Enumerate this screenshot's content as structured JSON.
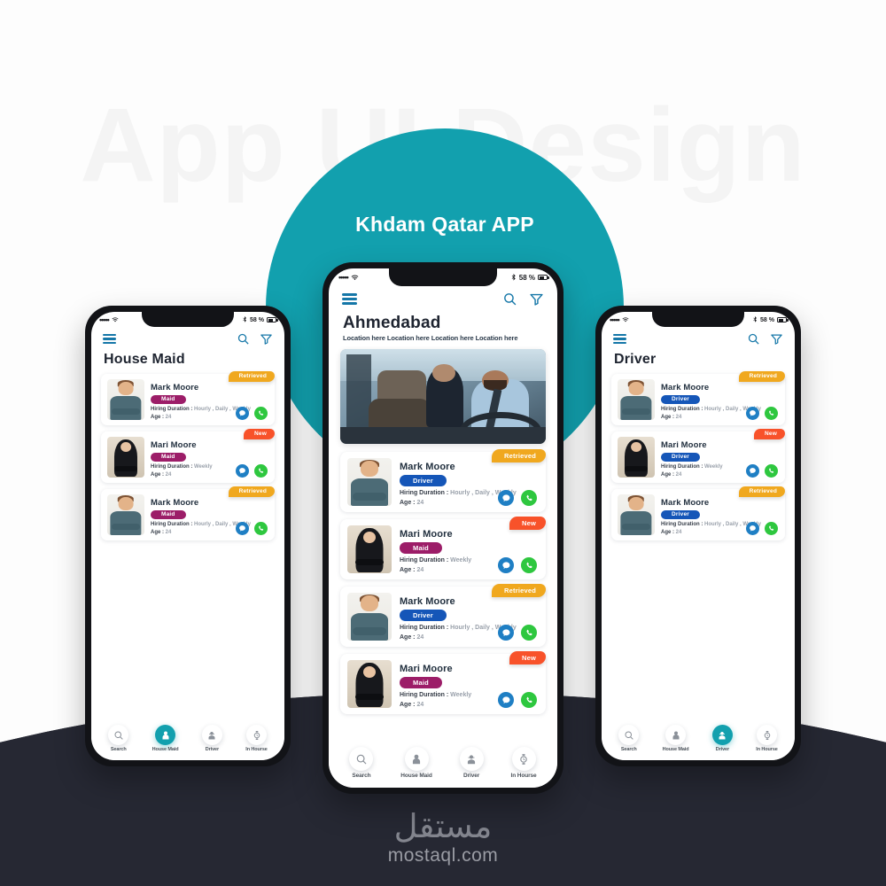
{
  "background": {
    "watermark_text": "App UI Design",
    "teal_color": "#12a0ae",
    "dark_color": "#262833"
  },
  "hero": {
    "title": "Khdam Qatar APP"
  },
  "footer_logo": {
    "arabic": "مستقل",
    "latin": "mostaql.com"
  },
  "status_bar": {
    "signal": "•••••",
    "battery_text": "58 %"
  },
  "icons": {
    "hamburger": "hamburger-menu-icon",
    "search": "search-icon",
    "filter": "filter-icon",
    "chat": "chat-bubble-icon",
    "call": "phone-call-icon"
  },
  "bottom_nav": {
    "items": [
      {
        "label": "Search",
        "icon": "search-icon"
      },
      {
        "label": "House Maid",
        "icon": "maid-person-icon"
      },
      {
        "label": "Driver",
        "icon": "driver-person-icon"
      },
      {
        "label": "In Hourse",
        "icon": "watch-clock-icon"
      }
    ]
  },
  "labels": {
    "hiring_duration": "Hiring Duration :",
    "age": "Age :"
  },
  "phones": {
    "left": {
      "title": "House Maid",
      "active_nav": "House Maid",
      "cards": [
        {
          "name": "Mark Moore",
          "role": "Maid",
          "role_type": "maid",
          "duration": "Hourly , Daily , Weekly",
          "age": "24",
          "status": "Retrieved",
          "status_type": "retrieved",
          "avatar": "male"
        },
        {
          "name": "Mari Moore",
          "role": "Maid",
          "role_type": "maid",
          "duration": "Weekly",
          "age": "24",
          "status": "New",
          "status_type": "new",
          "avatar": "female"
        },
        {
          "name": "Mark Moore",
          "role": "Maid",
          "role_type": "maid",
          "duration": "Hourly , Daily , Weekly",
          "age": "24",
          "status": "Retrieved",
          "status_type": "retrieved",
          "avatar": "male"
        }
      ]
    },
    "center": {
      "title": "Ahmedabad",
      "subtitle": "Location here Location here Location here Location here",
      "hero_image": "driver-and-passenger-in-car-photo",
      "active_nav": "",
      "cards": [
        {
          "name": "Mark Moore",
          "role": "Driver",
          "role_type": "driver",
          "duration": "Hourly , Daily , Weekly",
          "age": "24",
          "status": "Retrieved",
          "status_type": "retrieved",
          "avatar": "male"
        },
        {
          "name": "Mari Moore",
          "role": "Maid",
          "role_type": "maid",
          "duration": "Weekly",
          "age": "24",
          "status": "New",
          "status_type": "new",
          "avatar": "female"
        },
        {
          "name": "Mark Moore",
          "role": "Driver",
          "role_type": "driver",
          "duration": "Hourly , Daily , Weekly",
          "age": "24",
          "status": "Retrieved",
          "status_type": "retrieved",
          "avatar": "male"
        },
        {
          "name": "Mari Moore",
          "role": "Maid",
          "role_type": "maid",
          "duration": "Weekly",
          "age": "24",
          "status": "New",
          "status_type": "new",
          "avatar": "female"
        }
      ]
    },
    "right": {
      "title": "Driver",
      "active_nav": "Driver",
      "cards": [
        {
          "name": "Mark Moore",
          "role": "Driver",
          "role_type": "driver",
          "duration": "Hourly , Daily , Weekly",
          "age": "24",
          "status": "Retrieved",
          "status_type": "retrieved",
          "avatar": "male"
        },
        {
          "name": "Mari Moore",
          "role": "Driver",
          "role_type": "driver",
          "duration": "Weekly",
          "age": "24",
          "status": "New",
          "status_type": "new",
          "avatar": "female"
        },
        {
          "name": "Mark Moore",
          "role": "Driver",
          "role_type": "driver",
          "duration": "Hourly , Daily , Weekly",
          "age": "24",
          "status": "Retrieved",
          "status_type": "retrieved",
          "avatar": "male"
        }
      ]
    }
  }
}
